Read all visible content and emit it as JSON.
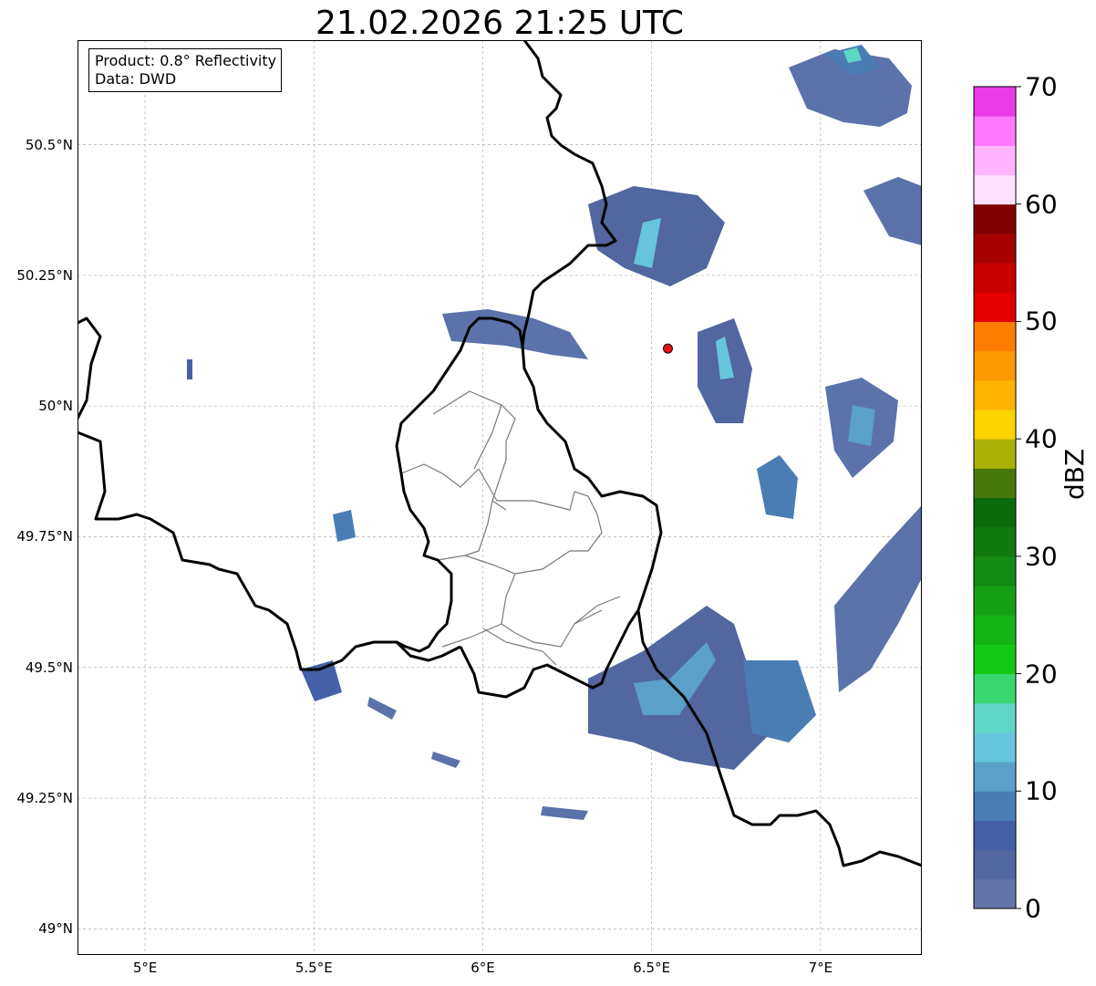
{
  "title": "21.02.2026 21:25 UTC",
  "info": {
    "product": "Product: 0.8° Reflectivity",
    "source": "Data: DWD"
  },
  "lat_ticks": [
    "50.5°N",
    "50.25°N",
    "50°N",
    "49.75°N",
    "49.5°N",
    "49.25°N",
    "49°N"
  ],
  "lon_ticks": [
    "5°E",
    "5.5°E",
    "6°E",
    "6.5°E",
    "7°E"
  ],
  "extent": {
    "lon_min": 4.8,
    "lon_max": 7.3,
    "lat_min": 48.95,
    "lat_max": 50.7
  },
  "colorbar": {
    "label": "dBZ",
    "ticks": [
      "0",
      "10",
      "20",
      "30",
      "40",
      "50",
      "60",
      "70"
    ],
    "colors": [
      "#6474a8",
      "#5266a0",
      "#4460a6",
      "#4a7db4",
      "#5aa0c8",
      "#66c4dc",
      "#5ed6c4",
      "#3ad670",
      "#14c814",
      "#14b414",
      "#14a014",
      "#128c12",
      "#107a10",
      "#0c6a0c",
      "#48780c",
      "#aab206",
      "#fcd400",
      "#fcb400",
      "#fc9800",
      "#fc7c00",
      "#e40000",
      "#c80000",
      "#a60000",
      "#800000",
      "#ffe0ff",
      "#ffb4ff",
      "#ff78ff",
      "#ea3aea"
    ]
  },
  "radar_site": {
    "lon": 6.548,
    "lat": 50.11,
    "color": "#e81010"
  },
  "gridline_color": "#b0b0b0"
}
